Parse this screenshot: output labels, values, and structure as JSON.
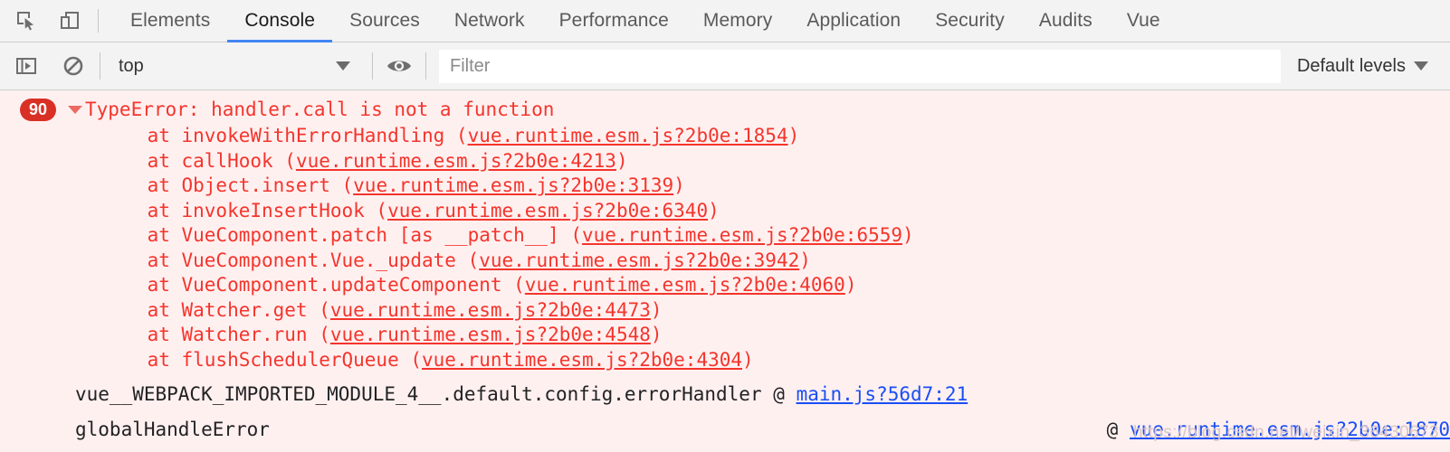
{
  "tabbar": {
    "icons": [
      {
        "name": "inspect-element-icon",
        "label": "Inspect element"
      },
      {
        "name": "device-toolbar-icon",
        "label": "Toggle device toolbar"
      }
    ],
    "tabs": [
      {
        "label": "Elements",
        "active": false
      },
      {
        "label": "Console",
        "active": true
      },
      {
        "label": "Sources",
        "active": false
      },
      {
        "label": "Network",
        "active": false
      },
      {
        "label": "Performance",
        "active": false
      },
      {
        "label": "Memory",
        "active": false
      },
      {
        "label": "Application",
        "active": false
      },
      {
        "label": "Security",
        "active": false
      },
      {
        "label": "Audits",
        "active": false
      },
      {
        "label": "Vue",
        "active": false
      }
    ],
    "active_tab": "Console",
    "active_underline_color": "#4285f4"
  },
  "filterbar": {
    "sidebar_toggle_icon": "console-sidebar-icon",
    "clear_console_icon": "clear-console-icon",
    "context_value": "top",
    "context_caret": "chevron-down-icon",
    "eye_icon": "eye-icon",
    "filter_placeholder": "Filter",
    "filter_value": "",
    "levels_label": "Default levels",
    "levels_caret": "chevron-down-icon"
  },
  "console": {
    "background": "#fff0f0",
    "error_color": "#f4352c",
    "link_color": "#1a4ef5",
    "badge_color": "#d93025",
    "error": {
      "count": "90",
      "expanded": true,
      "title": "TypeError: handler.call is not a function",
      "stack": [
        {
          "prefix": "    at invokeWithErrorHandling (",
          "link": "vue.runtime.esm.js?2b0e:1854",
          "suffix": ")"
        },
        {
          "prefix": "    at callHook (",
          "link": "vue.runtime.esm.js?2b0e:4213",
          "suffix": ")"
        },
        {
          "prefix": "    at Object.insert (",
          "link": "vue.runtime.esm.js?2b0e:3139",
          "suffix": ")"
        },
        {
          "prefix": "    at invokeInsertHook (",
          "link": "vue.runtime.esm.js?2b0e:6340",
          "suffix": ")"
        },
        {
          "prefix": "    at VueComponent.patch [as __patch__] (",
          "link": "vue.runtime.esm.js?2b0e:6559",
          "suffix": ")"
        },
        {
          "prefix": "    at VueComponent.Vue._update (",
          "link": "vue.runtime.esm.js?2b0e:3942",
          "suffix": ")"
        },
        {
          "prefix": "    at VueComponent.updateComponent (",
          "link": "vue.runtime.esm.js?2b0e:4060",
          "suffix": ")"
        },
        {
          "prefix": "    at Watcher.get (",
          "link": "vue.runtime.esm.js?2b0e:4473",
          "suffix": ")"
        },
        {
          "prefix": "    at Watcher.run (",
          "link": "vue.runtime.esm.js?2b0e:4548",
          "suffix": ")"
        },
        {
          "prefix": "    at flushSchedulerQueue (",
          "link": "vue.runtime.esm.js?2b0e:4304",
          "suffix": ")"
        }
      ],
      "origins": [
        {
          "text": "vue__WEBPACK_IMPORTED_MODULE_4__.default.config.errorHandler",
          "at": "@",
          "link": "main.js?56d7:21"
        },
        {
          "text": "globalHandleError",
          "at": "@",
          "link": "vue.runtime.esm.js?2b0e:1870"
        }
      ]
    }
  },
  "watermark": {
    "text": "https://blog.csdn.net/weixin_36430673"
  }
}
